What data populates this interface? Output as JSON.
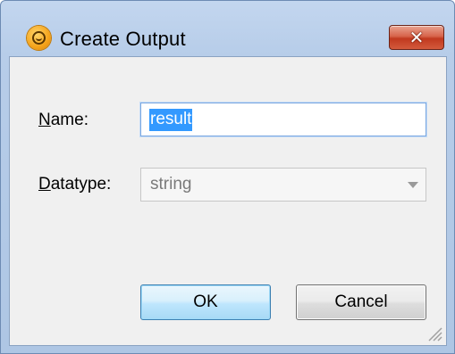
{
  "window": {
    "title": "Create Output",
    "close_symbol": "✕",
    "app_icon": "altova-mapforce-icon"
  },
  "form": {
    "name_label_accesskey": "N",
    "name_label_rest": "ame:",
    "name_value": "result",
    "datatype_label_accesskey": "D",
    "datatype_label_rest": "atatype:",
    "datatype_value": "string"
  },
  "buttons": {
    "ok_label": "OK",
    "cancel_label": "Cancel"
  },
  "colors": {
    "title_bar": "#b7cde9",
    "close_button": "#c1391f",
    "selection": "#3399ff",
    "ok_button_border": "#3c7fb1"
  }
}
